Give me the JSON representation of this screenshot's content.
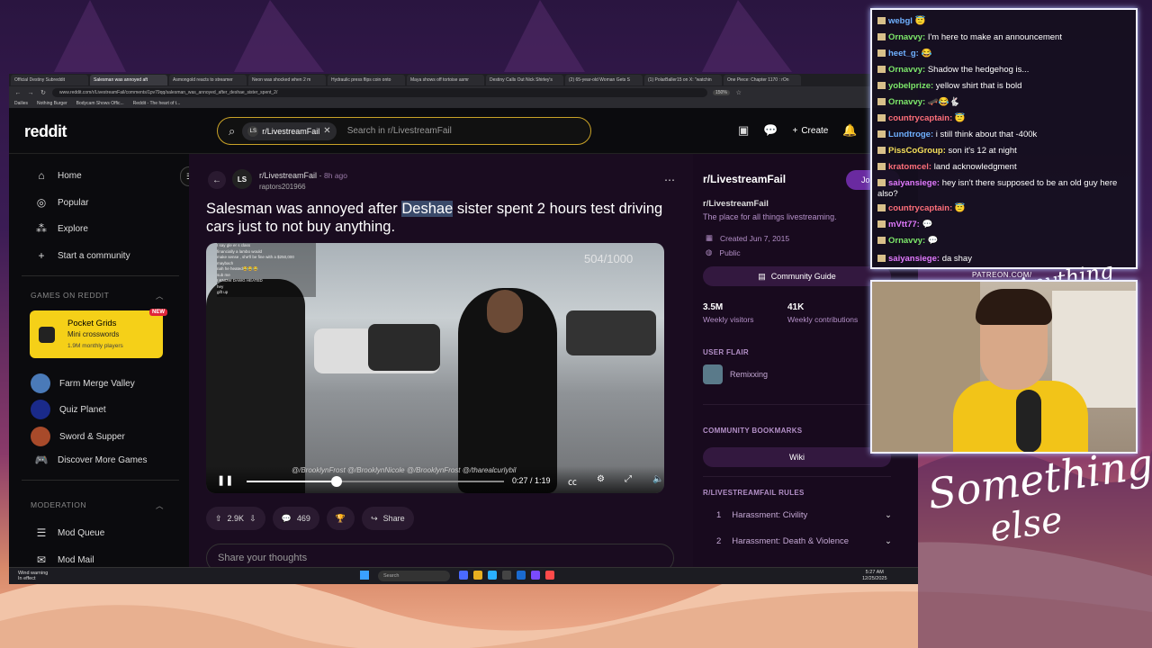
{
  "browser": {
    "tabs": [
      "Official Destiny Subreddit",
      "Salesman was annoyed aft",
      "Asmongold reacts to streamer",
      "Neon was shocked when 2 m",
      "Hydraulic press flips coin onto",
      "Maya shows off tortoise asmr",
      "Destiny Calls Out Nick Shirley's",
      "(2) 65-year-old Woman Gets S",
      "(1) PolarBaller15 on X: \"watchin",
      "One Piece: Chapter 1170 : rOn"
    ],
    "url": "www.reddit.com/r/LivestreamFail/comments/1pv79qq/salesman_was_annoyed_after_deshae_sister_spent_2/",
    "zoom": "150%",
    "bookmarks": [
      "Dailies",
      "Nothing Burger",
      "Bodycam Shows Offic...",
      "Reddit - The heart of t..."
    ]
  },
  "header": {
    "logo": "reddit",
    "search_chip": "r/LivestreamFail",
    "search_chip_icon": "LS",
    "search_placeholder": "Search in r/LivestreamFail",
    "create_label": "Create"
  },
  "sidebar": {
    "nav": [
      {
        "label": "Home",
        "icon": "⌂"
      },
      {
        "label": "Popular",
        "icon": "◎"
      },
      {
        "label": "Explore",
        "icon": "⁂"
      },
      {
        "label": "Start a community",
        "icon": "+"
      }
    ],
    "games_heading": "GAMES ON REDDIT",
    "featured_game": {
      "title": "Pocket Grids",
      "subtitle": "Mini crosswords",
      "players": "1.9M monthly players",
      "badge": "NEW"
    },
    "games": [
      {
        "label": "Farm Merge Valley",
        "color": "#4a7ab8"
      },
      {
        "label": "Quiz Planet",
        "color": "#1a2a8a"
      },
      {
        "label": "Sword & Supper",
        "color": "#a84a2a"
      },
      {
        "label": "Discover More Games",
        "color": "#222"
      }
    ],
    "mod_heading": "MODERATION",
    "mod_items": [
      {
        "label": "Mod Queue",
        "icon": "☰"
      },
      {
        "label": "Mod Mail",
        "icon": "✉"
      }
    ]
  },
  "post": {
    "subreddit": "r/LivestreamFail",
    "subreddit_icon": "LS",
    "time": "8h ago",
    "author": "raptors201966",
    "title_before": "Salesman was annoyed after ",
    "title_highlight": "Deshae",
    "title_after": " sister spent 2 hours test driving cars just to not buy anything.",
    "video": {
      "counter": "504/1000",
      "chat_lines": [
        "I say gle er s class",
        "financially a lambo would",
        "make sense , she'll be fine with a $250,000",
        "maybach",
        "nah he heated😂😂😂",
        "sub me",
        "I KNOW DAWG HEATED",
        "hey",
        "gift up"
      ],
      "time": "0:27 / 1:19",
      "progress": 0.35,
      "tags": "@/BrooklynFrost  @/BrooklynNicole  @/BrooklynFrost  @/tharealcurlybil"
    },
    "actions": {
      "votes": "2.9K",
      "comments": "469",
      "share": "Share"
    },
    "comment_placeholder": "Share your thoughts"
  },
  "right_sidebar": {
    "title": "r/LivestreamFail",
    "join": "Jo",
    "name": "r/LivestreamFail",
    "description": "The place for all things livestreaming.",
    "created": "Created Jun 7, 2015",
    "visibility": "Public",
    "guide_btn": "Community Guide",
    "stats": [
      {
        "value": "3.5M",
        "label": "Weekly visitors"
      },
      {
        "value": "41K",
        "label": "Weekly contributions"
      }
    ],
    "flair_heading": "USER FLAIR",
    "flair": "Remixxing",
    "bookmarks_heading": "COMMUNITY BOOKMARKS",
    "wiki": "Wiki",
    "rules_heading": "R/LIVESTREAMFAIL RULES",
    "rules": [
      {
        "num": "1",
        "text": "Harassment: Civility"
      },
      {
        "num": "2",
        "text": "Harassment: Death & Violence"
      }
    ]
  },
  "taskbar": {
    "weather_line1": "Wind warning",
    "weather_line2": "In effect",
    "search": "Search",
    "time": "5:27 AM",
    "date": "12/25/2025"
  },
  "chat": [
    {
      "user": "webgl",
      "color": "#6fb0ff",
      "msg": "😇"
    },
    {
      "user": "Ornavvy:",
      "color": "#7de86a",
      "msg": "I'm here to make an announcement"
    },
    {
      "user": "heet_g:",
      "color": "#6fb0ff",
      "msg": "😂"
    },
    {
      "user": "Ornavvy:",
      "color": "#7de86a",
      "msg": "Shadow the hedgehog is..."
    },
    {
      "user": "yobelprize:",
      "color": "#7de86a",
      "msg": "yellow shirt that is bold"
    },
    {
      "user": "Ornavvy:",
      "color": "#7de86a",
      "msg": "🛹😂🐇"
    },
    {
      "user": "countrycaptain:",
      "color": "#ff6f7a",
      "msg": "😇"
    },
    {
      "user": "Lundtroge:",
      "color": "#6fb0ff",
      "msg": "i still think about that -400k"
    },
    {
      "user": "PissCoGroup:",
      "color": "#f6e05a",
      "msg": "son it's 12 at night"
    },
    {
      "user": "kratomcel:",
      "color": "#ff6f7a",
      "msg": "land acknowledgment"
    },
    {
      "user": "saiyansiege:",
      "color": "#e27aff",
      "msg": "hey isn't there supposed to be an old guy here also?"
    },
    {
      "user": "countrycaptain:",
      "color": "#ff6f7a",
      "msg": "😇"
    },
    {
      "user": "mVtt77:",
      "color": "#e27aff",
      "msg": "💬"
    },
    {
      "user": "Ornavvy:",
      "color": "#7de86a",
      "msg": "💬"
    },
    {
      "user": "saiyansiege:",
      "color": "#e27aff",
      "msg": "da shay"
    }
  ],
  "overlay": {
    "patreon": "PATREON.COM/",
    "script_top": "Anything else",
    "script_bottom_1": "Something",
    "script_bottom_2": "else"
  }
}
